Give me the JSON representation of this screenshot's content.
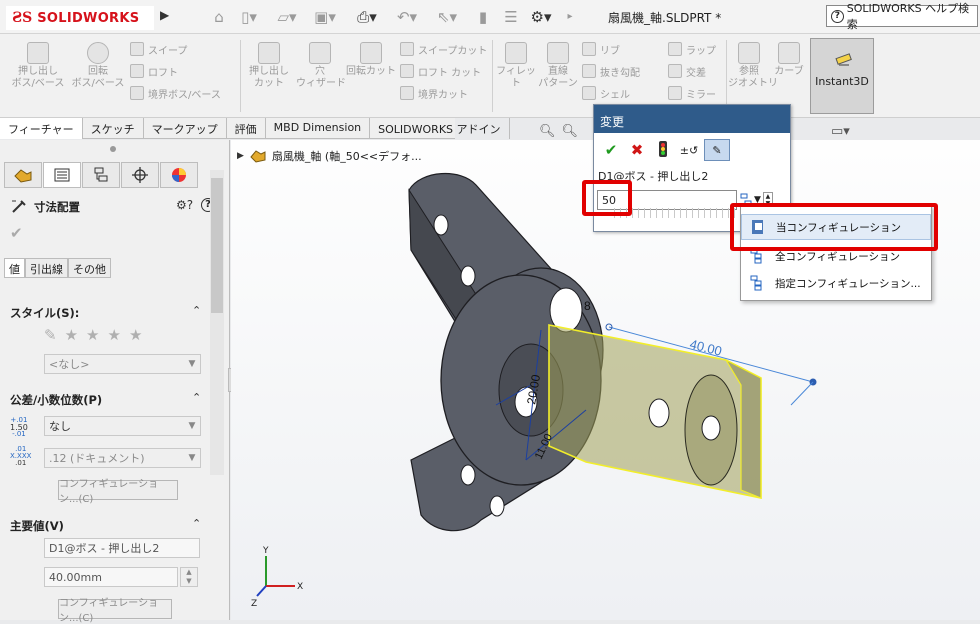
{
  "app": {
    "logo_text": "SOLIDWORKS",
    "doc_title": "扇風機_軸.SLDPRT *",
    "help_search": "SOLIDWORKS ヘルプ検索"
  },
  "commands": {
    "extrude_boss": "押し出し\nボス/ベース",
    "revolve_boss": "回転\nボス/ベース",
    "sweep": "スイープ",
    "loft": "ロフト",
    "boundary_boss": "境界ボス/ベース",
    "extrude_cut": "押し出し\nカット",
    "hole_wizard": "穴\nウィザード",
    "revolve_cut": "回転カット",
    "sweep_cut": "スイープカット",
    "loft_cut": "ロフト カット",
    "boundary_cut": "境界カット",
    "fillet": "フィレット",
    "linear_pattern": "直線\nパターン",
    "rib": "リブ",
    "draft": "抜き勾配",
    "shell": "シェル",
    "wrap": "ラップ",
    "intersect": "交差",
    "mirror": "ミラー",
    "ref_geometry": "参照\nジオメトリ",
    "curves": "カーブ",
    "instant3d": "Instant3D"
  },
  "tabs": [
    "フィーチャー",
    "スケッチ",
    "マークアップ",
    "評価",
    "MBD Dimension",
    "SOLIDWORKS アドイン"
  ],
  "left_panel": {
    "title": "寸法配置",
    "subtabs": [
      "値",
      "引出線",
      "その他"
    ],
    "style_header": "スタイル(S):",
    "style_value": "<なし>",
    "tolerance_header": "公差/小数位数(P)",
    "tolerance_value": "なし",
    "precision_value": ".12 (ドキュメント)",
    "config_button": "コンフィギュレーション...(C)",
    "primary_header": "主要値(V)",
    "primary_name": "D1@ボス - 押し出し2",
    "primary_value": "40.00mm",
    "config_button2": "コンフィギュレーション...(C)",
    "tol_icon_top": "+.01",
    "tol_icon_mid": "1.50",
    "tol_icon_bot": "-.01",
    "prec_icon_top": ".01",
    "prec_icon_mid": "X.XXX",
    "prec_icon_bot": ".01"
  },
  "tree": {
    "root": "扇風機_軸 (軸_50<<デフォ..."
  },
  "model": {
    "dim_a": "40.00",
    "dim_b": "20.00",
    "dim_c": "11.00",
    "dim_d": "8"
  },
  "modify_dialog": {
    "title": "変更",
    "dim_name": "D1@ボス - 押し出し2",
    "input_value": "50"
  },
  "config_menu": {
    "items": [
      "当コンフィギュレーション",
      "全コンフィギュレーション",
      "指定コンフィギュレーション..."
    ]
  },
  "triad": {
    "x": "X",
    "y": "Y",
    "z": "Z"
  }
}
